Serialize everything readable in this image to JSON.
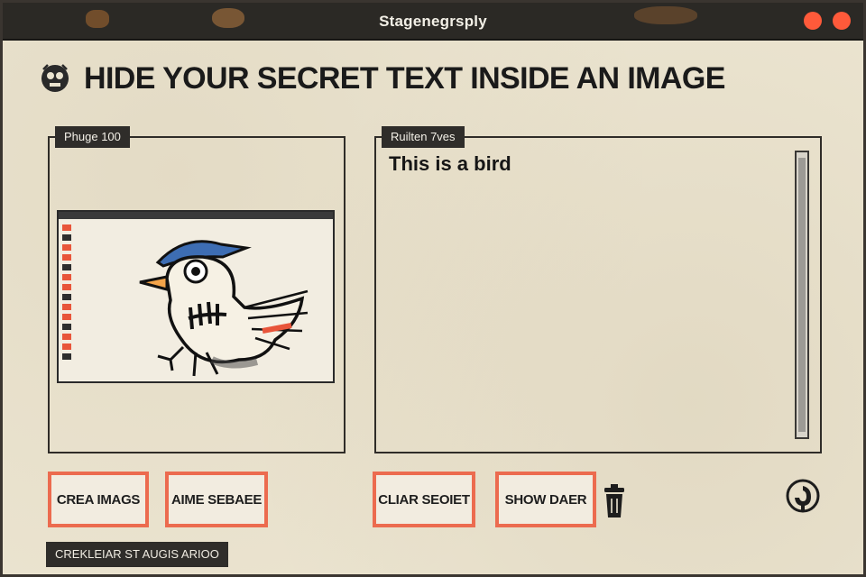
{
  "window": {
    "title": "Stagenegrsply"
  },
  "header": {
    "title": "HIDE YOUR SECRET TEXT INSIDE AN IMAGE",
    "icon": "skull-badge-icon"
  },
  "left_panel": {
    "label": "Phuge 100",
    "preview_icon": "bird-drawing",
    "strip_colors": [
      "#e8553a",
      "#2e2e2e"
    ]
  },
  "right_panel": {
    "label": "Ruilten 7ves",
    "text_value": "This is a bird"
  },
  "buttons": {
    "create_image": "CREA IMAGS",
    "save_image": "AIME SEBAEE",
    "clear_secret": "CLIAR SEOIET",
    "show_data": "SHOW DAER"
  },
  "icons": {
    "trash": "trash-icon",
    "settings": "circle-settings-icon"
  },
  "status": {
    "text": "CREKLEIAR ST AUGIS ARIOO"
  },
  "colors": {
    "accent": "#ec6b4f",
    "window_controls": "#ff5a3a",
    "dark": "#2f2d2a",
    "background": "#ebe4d0"
  }
}
